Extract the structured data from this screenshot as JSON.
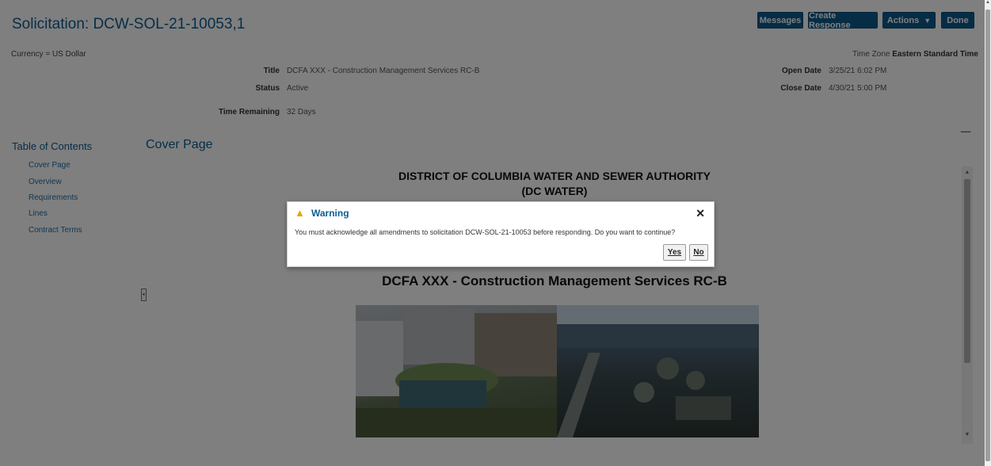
{
  "header": {
    "title": "Solicitation: DCW-SOL-21-10053,1",
    "buttons": {
      "messages": "Messages",
      "create_response": "Create Response",
      "actions": "Actions",
      "done": "Done"
    }
  },
  "info": {
    "currency": "Currency = US Dollar",
    "timezone_label": "Time Zone",
    "timezone_value": "Eastern Standard Time",
    "fields": {
      "title_label": "Title",
      "title_value": "DCFA XXX - Construction Management Services RC-B",
      "status_label": "Status",
      "status_value": "Active",
      "time_remaining_label": "Time Remaining",
      "time_remaining_value": "32 Days",
      "open_date_label": "Open Date",
      "open_date_value": "3/25/21 6:02 PM",
      "close_date_label": "Close Date",
      "close_date_value": "4/30/21 5:00 PM"
    }
  },
  "toc": {
    "title": "Table of Contents",
    "items": [
      "Cover Page",
      "Overview",
      "Requirements",
      "Lines",
      "Contract Terms"
    ]
  },
  "cover": {
    "section_title": "Cover Page",
    "org_line1": "DISTRICT OF COLUMBIA WATER AND SEWER AUTHORITY",
    "org_line2": "(DC WATER)",
    "doc_title": "DCFA XXX - Construction Management Services RC-B"
  },
  "dialog": {
    "title": "Warning",
    "message": "You must acknowledge all amendments to solicitation DCW-SOL-21-10053 before responding. Do you want to continue?",
    "yes": "Yes",
    "no": "No"
  },
  "colors": {
    "brand": "#0b5d92",
    "button": "#0d5a8c",
    "warning": "#e7a600"
  }
}
